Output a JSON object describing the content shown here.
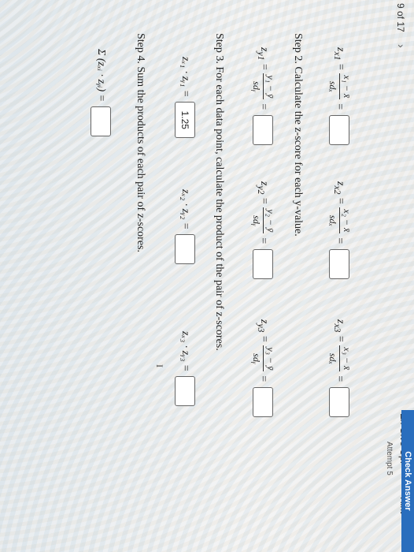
{
  "header": {
    "page_counter": "9 of 17",
    "next_icon": "chevron-right",
    "give_up_label": "Ex Give Up!",
    "hint_label": "Hint",
    "check_answer_label": "Check Answer",
    "attempt_label": "Attempt 5"
  },
  "step1": {
    "zx1_lhs": "z",
    "zx1_sub": "x1",
    "zx1_num": "x₁ − x̄",
    "zx1_den": "sdₓ",
    "zx2_lhs": "z",
    "zx2_sub": "x2",
    "zx2_num": "x₂ − x̄",
    "zx2_den": "sdₓ",
    "zx3_lhs": "z",
    "zx3_sub": "x3",
    "zx3_num": "x₃ − x̄",
    "zx3_den": "sdₓ"
  },
  "step2": {
    "title": "Step 2. Calculate the z-score for each y-value.",
    "zy1_lhs": "z",
    "zy1_sub": "y1",
    "zy1_num": "y₁ − ȳ",
    "zy1_den": "sdᵧ",
    "zy2_lhs": "z",
    "zy2_sub": "y2",
    "zy2_num": "y₂ − ȳ",
    "zy2_den": "sdᵧ",
    "zy3_lhs": "z",
    "zy3_sub": "y3",
    "zy3_num": "y₃ − ȳ",
    "zy3_den": "sdᵧ"
  },
  "step3": {
    "title": "Step 3. For each data point, calculate the product of the pair of z-scores.",
    "p1_label": "zₓ₁ · zᵧ₁ =",
    "p1_value": "1.25",
    "p2_label": "zₓ₂ · zᵧ₂ =",
    "p2_value": "",
    "p3_label": "zₓ₃ · zᵧ₃ =",
    "p3_value": ""
  },
  "step4": {
    "title": "Step 4. Sum the products of each pair of z-scores.",
    "sum_label": "Σ (zₓᵢ · zᵧᵢ) =",
    "sum_value": ""
  }
}
